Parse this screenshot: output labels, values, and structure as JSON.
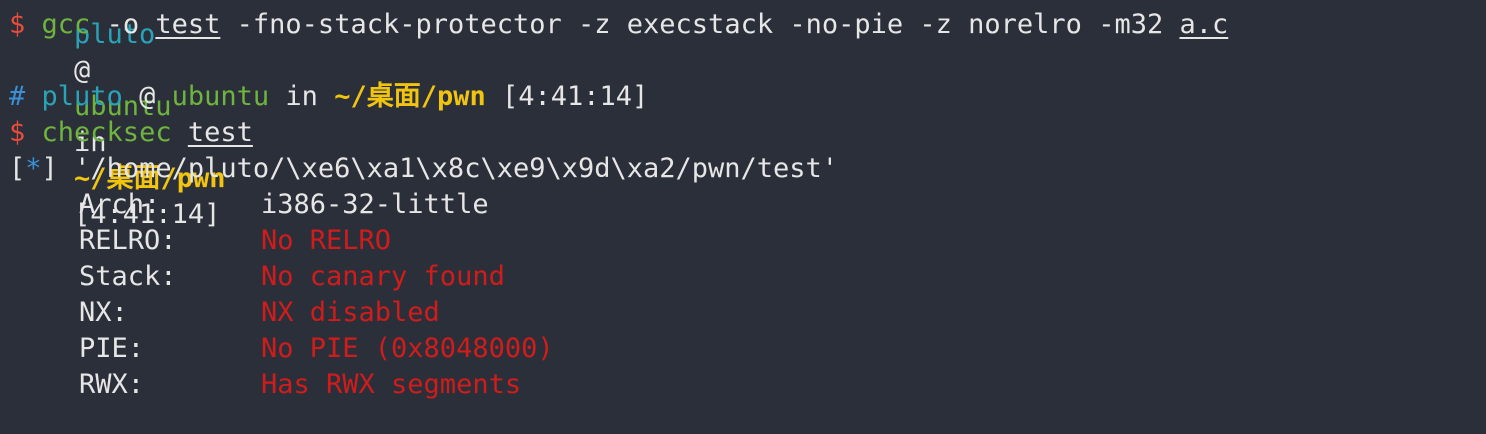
{
  "partial_top_line": {
    "user": "pluto",
    "at": "@",
    "host": "ubuntu",
    "in": "in",
    "path": "~/桌面/pwn",
    "time": "[4:41:14]"
  },
  "gcc_line": {
    "dollar": "$",
    "cmd": "gcc",
    "arg1": "-o",
    "output": "test",
    "flags": "-fno-stack-protector -z execstack -no-pie -z norelro -m32",
    "source": "a.c"
  },
  "prompt_line": {
    "hash": "#",
    "user": "pluto",
    "at": "@",
    "host": "ubuntu",
    "in": "in",
    "path": "~/桌面/pwn",
    "time": "[4:41:14]"
  },
  "checksec_line": {
    "dollar": "$",
    "cmd": "checksec",
    "target": "test"
  },
  "result_header": {
    "marker_open": "[",
    "marker_star": "*",
    "marker_close": "]",
    "file": "'/home/pluto/\\xe6\\xa1\\x8c\\xe9\\x9d\\xa2/pwn/test'"
  },
  "checksec_results": [
    {
      "label": "Arch:",
      "value": "i386-32-little",
      "color": "normal"
    },
    {
      "label": "RELRO:",
      "value": "No RELRO",
      "color": "red"
    },
    {
      "label": "Stack:",
      "value": "No canary found",
      "color": "red"
    },
    {
      "label": "NX:",
      "value": "NX disabled",
      "color": "red"
    },
    {
      "label": "PIE:",
      "value": "No PIE (0x8048000)",
      "color": "red"
    },
    {
      "label": "RWX:",
      "value": "Has RWX segments",
      "color": "red"
    }
  ],
  "colors": {
    "background": "#2b2f39",
    "prompt_dollar": "#e74c3c",
    "command": "#6fb43f",
    "path": "#f1c40f",
    "user": "#2aa3b7",
    "warning": "#d11c1c"
  }
}
